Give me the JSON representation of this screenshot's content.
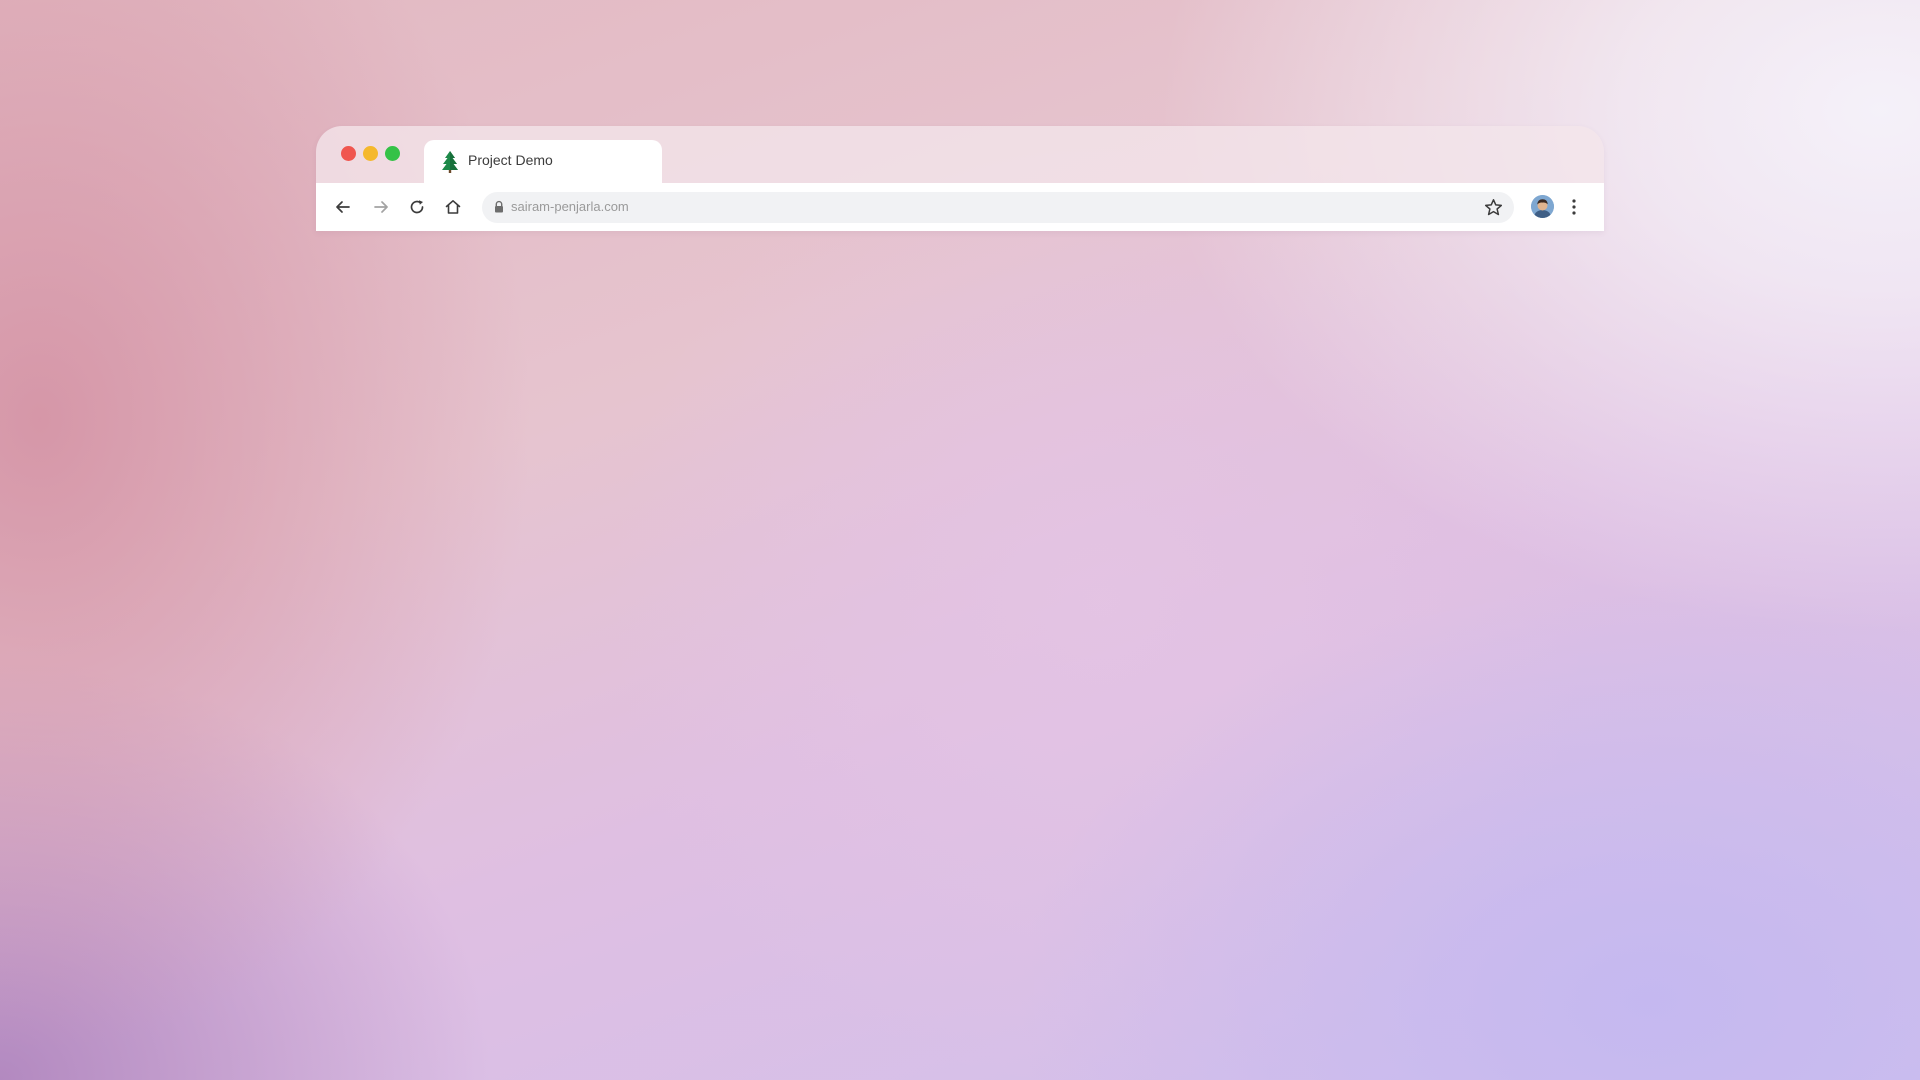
{
  "tab": {
    "title": "Project Demo",
    "icon": "pine-tree-icon"
  },
  "address_bar": {
    "url": "sairam-penjarla.com",
    "security_icon": "lock-icon"
  },
  "toolbar": {
    "back_icon": "arrow-left-icon",
    "forward_icon": "arrow-right-icon",
    "reload_icon": "reload-icon",
    "home_icon": "home-icon",
    "bookmark_icon": "star-icon",
    "profile_icon": "avatar",
    "menu_icon": "kebab-menu-icon"
  },
  "colors": {
    "close": "#f0564f",
    "minimize": "#f5b82c",
    "maximize": "#35c247",
    "favicon": "#1e8a4a"
  }
}
